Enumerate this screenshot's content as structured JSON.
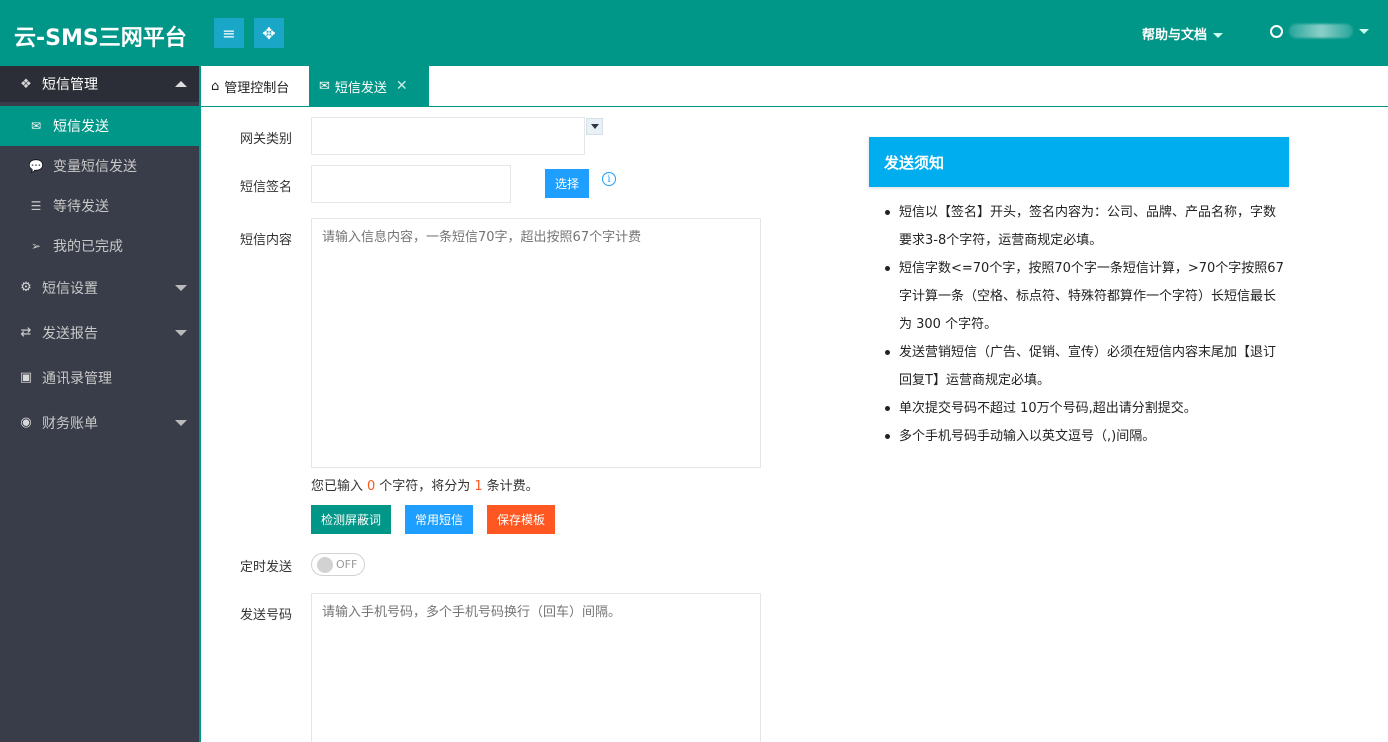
{
  "header": {
    "brand": "云-SMS三网平台",
    "help_label": "帮助与文档"
  },
  "sidebar": {
    "groups": [
      {
        "label": "短信管理",
        "icon": "cubes-icon",
        "expanded": true,
        "items": [
          {
            "label": "短信发送",
            "icon": "envelope-icon",
            "active": true
          },
          {
            "label": "变量短信发送",
            "icon": "comments-icon"
          },
          {
            "label": "等待发送",
            "icon": "list-icon"
          },
          {
            "label": "我的已完成",
            "icon": "paper-plane-icon"
          }
        ]
      },
      {
        "label": "短信设置",
        "icon": "gears-icon"
      },
      {
        "label": "发送报告",
        "icon": "exchange-icon"
      },
      {
        "label": "通讯录管理",
        "icon": "contact-book-icon"
      },
      {
        "label": "财务账单",
        "icon": "circle-dot-icon"
      }
    ]
  },
  "tabs": [
    {
      "label": "管理控制台",
      "icon": "home-icon"
    },
    {
      "label": "短信发送",
      "icon": "envelope-icon",
      "active": true
    }
  ],
  "form": {
    "gateway_label": "网关类别",
    "gateway_value": "",
    "signature_label": "短信签名",
    "signature_value": "",
    "select_button": "选择",
    "content_label": "短信内容",
    "content_placeholder": "请输入信息内容，一条短信70字，超出按照67个字计费",
    "counter_prefix": "您已输入",
    "char_count": "0",
    "counter_mid": "个字符，将分为",
    "sms_count": "1",
    "counter_suffix": "条计费。",
    "check_button": "检测屏蔽词",
    "common_button": "常用短信",
    "save_template_button": "保存模板",
    "schedule_label": "定时发送",
    "schedule_toggle": "OFF",
    "numbers_label": "发送号码",
    "numbers_placeholder": "请输入手机号码，多个手机号码换行（回车）间隔。"
  },
  "notice": {
    "title": "发送须知",
    "items": [
      "短信以【签名】开头，签名内容为：公司、品牌、产品名称，字数要求3-8个字符，运营商规定必填。",
      "短信字数<=70个字，按照70个字一条短信计算，>70个字按照67字计算一条（空格、标点符、特殊符都算作一个字符）长短信最长为 300 个字符。",
      "发送营销短信（广告、促销、宣传）必须在短信内容末尾加【退订回复T】运营商规定必填。",
      "单次提交号码不超过 10万个号码,超出请分割提交。",
      "多个手机号码手动输入以英文逗号（,)间隔。"
    ]
  },
  "colors": {
    "header": "#009688",
    "sidebar": "#393d49",
    "notice_header": "#00aeef",
    "select_button": "#1e9fff",
    "check_button": "#009688",
    "common_button": "#1e9fff",
    "save_button": "#ff5722"
  }
}
